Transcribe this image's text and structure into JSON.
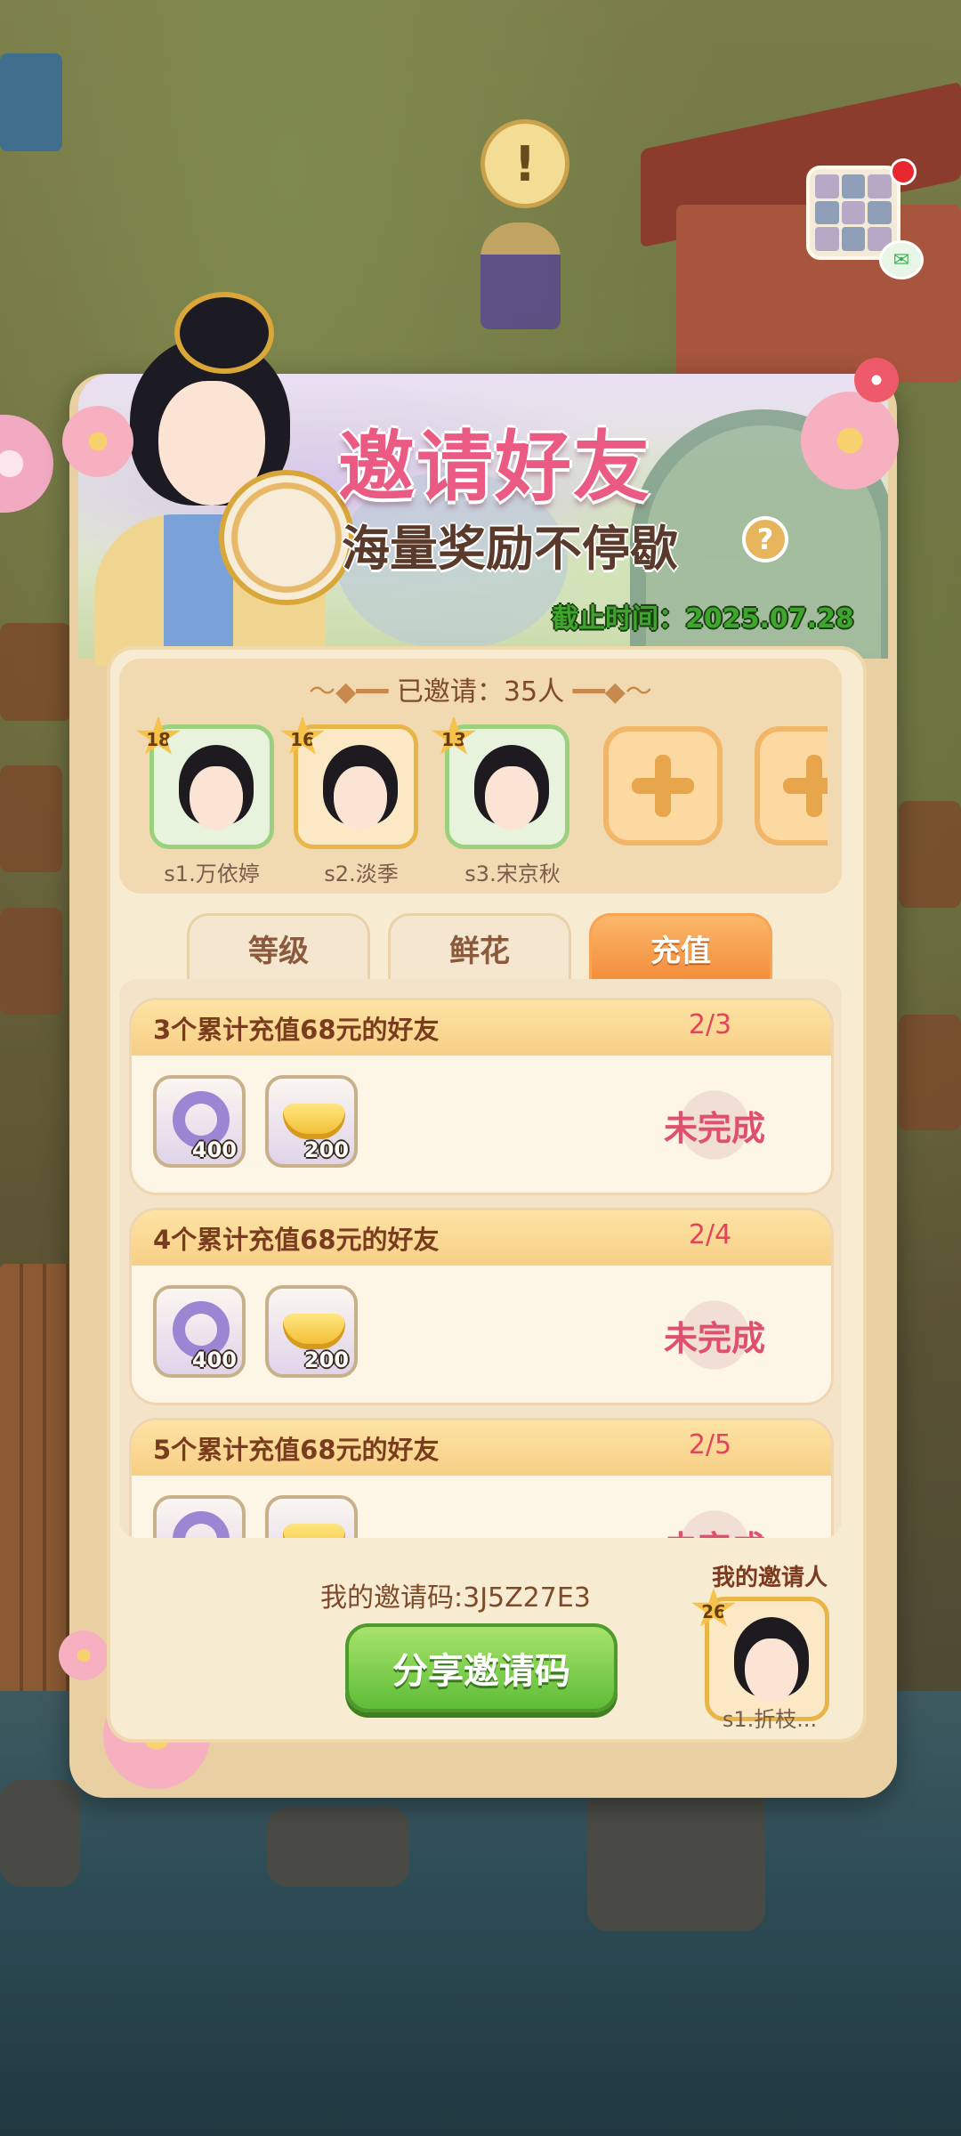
{
  "panel": {
    "title": "邀请好友",
    "subtitle": "海量奖励不停歇",
    "help_icon": "question-icon",
    "deadline": "截止时间：2025.07.28"
  },
  "invited": {
    "label": "已邀请：35人",
    "friends": [
      {
        "level": "18",
        "name": "s1.万依婷"
      },
      {
        "level": "16",
        "name": "s2.淡季"
      },
      {
        "level": "13",
        "name": "s3.宋京秋"
      }
    ],
    "add_icon": "plus-icon"
  },
  "tabs": [
    {
      "label": "等级",
      "active": false
    },
    {
      "label": "鲜花",
      "active": false
    },
    {
      "label": "充值",
      "active": true
    }
  ],
  "tasks": [
    {
      "desc": "3个累计充值68元的好友",
      "progress": "2/3",
      "status": "未完成",
      "rewards": [
        {
          "icon": "purple-ring-icon",
          "count": "400"
        },
        {
          "icon": "gold-ingot-icon",
          "count": "200"
        }
      ]
    },
    {
      "desc": "4个累计充值68元的好友",
      "progress": "2/4",
      "status": "未完成",
      "rewards": [
        {
          "icon": "purple-ring-icon",
          "count": "400"
        },
        {
          "icon": "gold-ingot-icon",
          "count": "200"
        }
      ]
    },
    {
      "desc": "5个累计充值68元的好友",
      "progress": "2/5",
      "status": "未完成",
      "rewards": [
        {
          "icon": "purple-ring-icon",
          "count": ""
        },
        {
          "icon": "gold-ingot-icon",
          "count": ""
        }
      ]
    }
  ],
  "footer": {
    "my_code": "我的邀请码:3J5Z27E3",
    "share_button": "分享邀请码",
    "inviter_title": "我的邀请人",
    "inviter_level": "26",
    "inviter_name": "s1.折枝..."
  },
  "scene": {
    "alert_icon": "!",
    "wechat_icon": "wechat-icon"
  },
  "colors": {
    "title_pink": "#ea5a82",
    "deadline_green": "#3ea52d",
    "active_tab": "#f38d3a",
    "progress_red": "#e0455b",
    "share_green": "#5fbd38"
  }
}
